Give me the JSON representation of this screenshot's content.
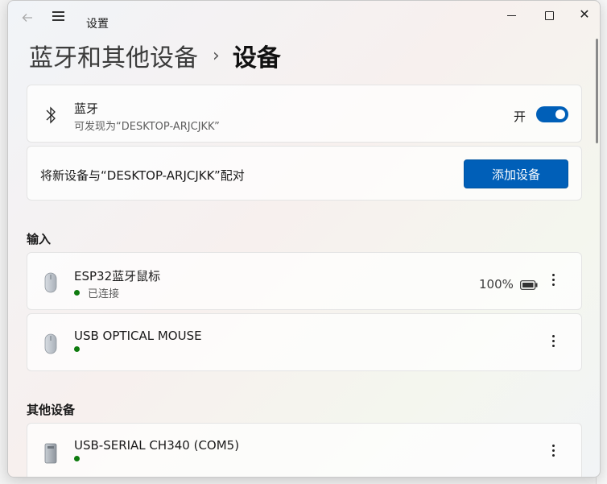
{
  "window": {
    "title": "设置",
    "back_icon": "arrow-left-icon",
    "menu_icon": "hamburger-icon",
    "close_glyph": "✕"
  },
  "breadcrumb": {
    "parent": "蓝牙和其他设备",
    "separator": "›",
    "current": "设备"
  },
  "bluetooth": {
    "title": "蓝牙",
    "subtitle": "可发现为“DESKTOP-ARJCJKK”",
    "toggle_label": "开",
    "toggle_on": true
  },
  "pair": {
    "text": "将新设备与“DESKTOP-ARJCJKK”配对",
    "button": "添加设备"
  },
  "sections": {
    "input": "输入",
    "other": "其他设备"
  },
  "devices": [
    {
      "name": "ESP32蓝牙鼠标",
      "status": "已连接",
      "battery": "100%",
      "icon": "mouse-icon"
    },
    {
      "name": "USB OPTICAL MOUSE",
      "status": "",
      "icon": "mouse-icon"
    },
    {
      "name": "USB-SERIAL CH340 (COM5)",
      "status": "",
      "icon": "usb-device-icon"
    }
  ],
  "colors": {
    "accent": "#005fb8",
    "connected": "#0f7b0f"
  }
}
